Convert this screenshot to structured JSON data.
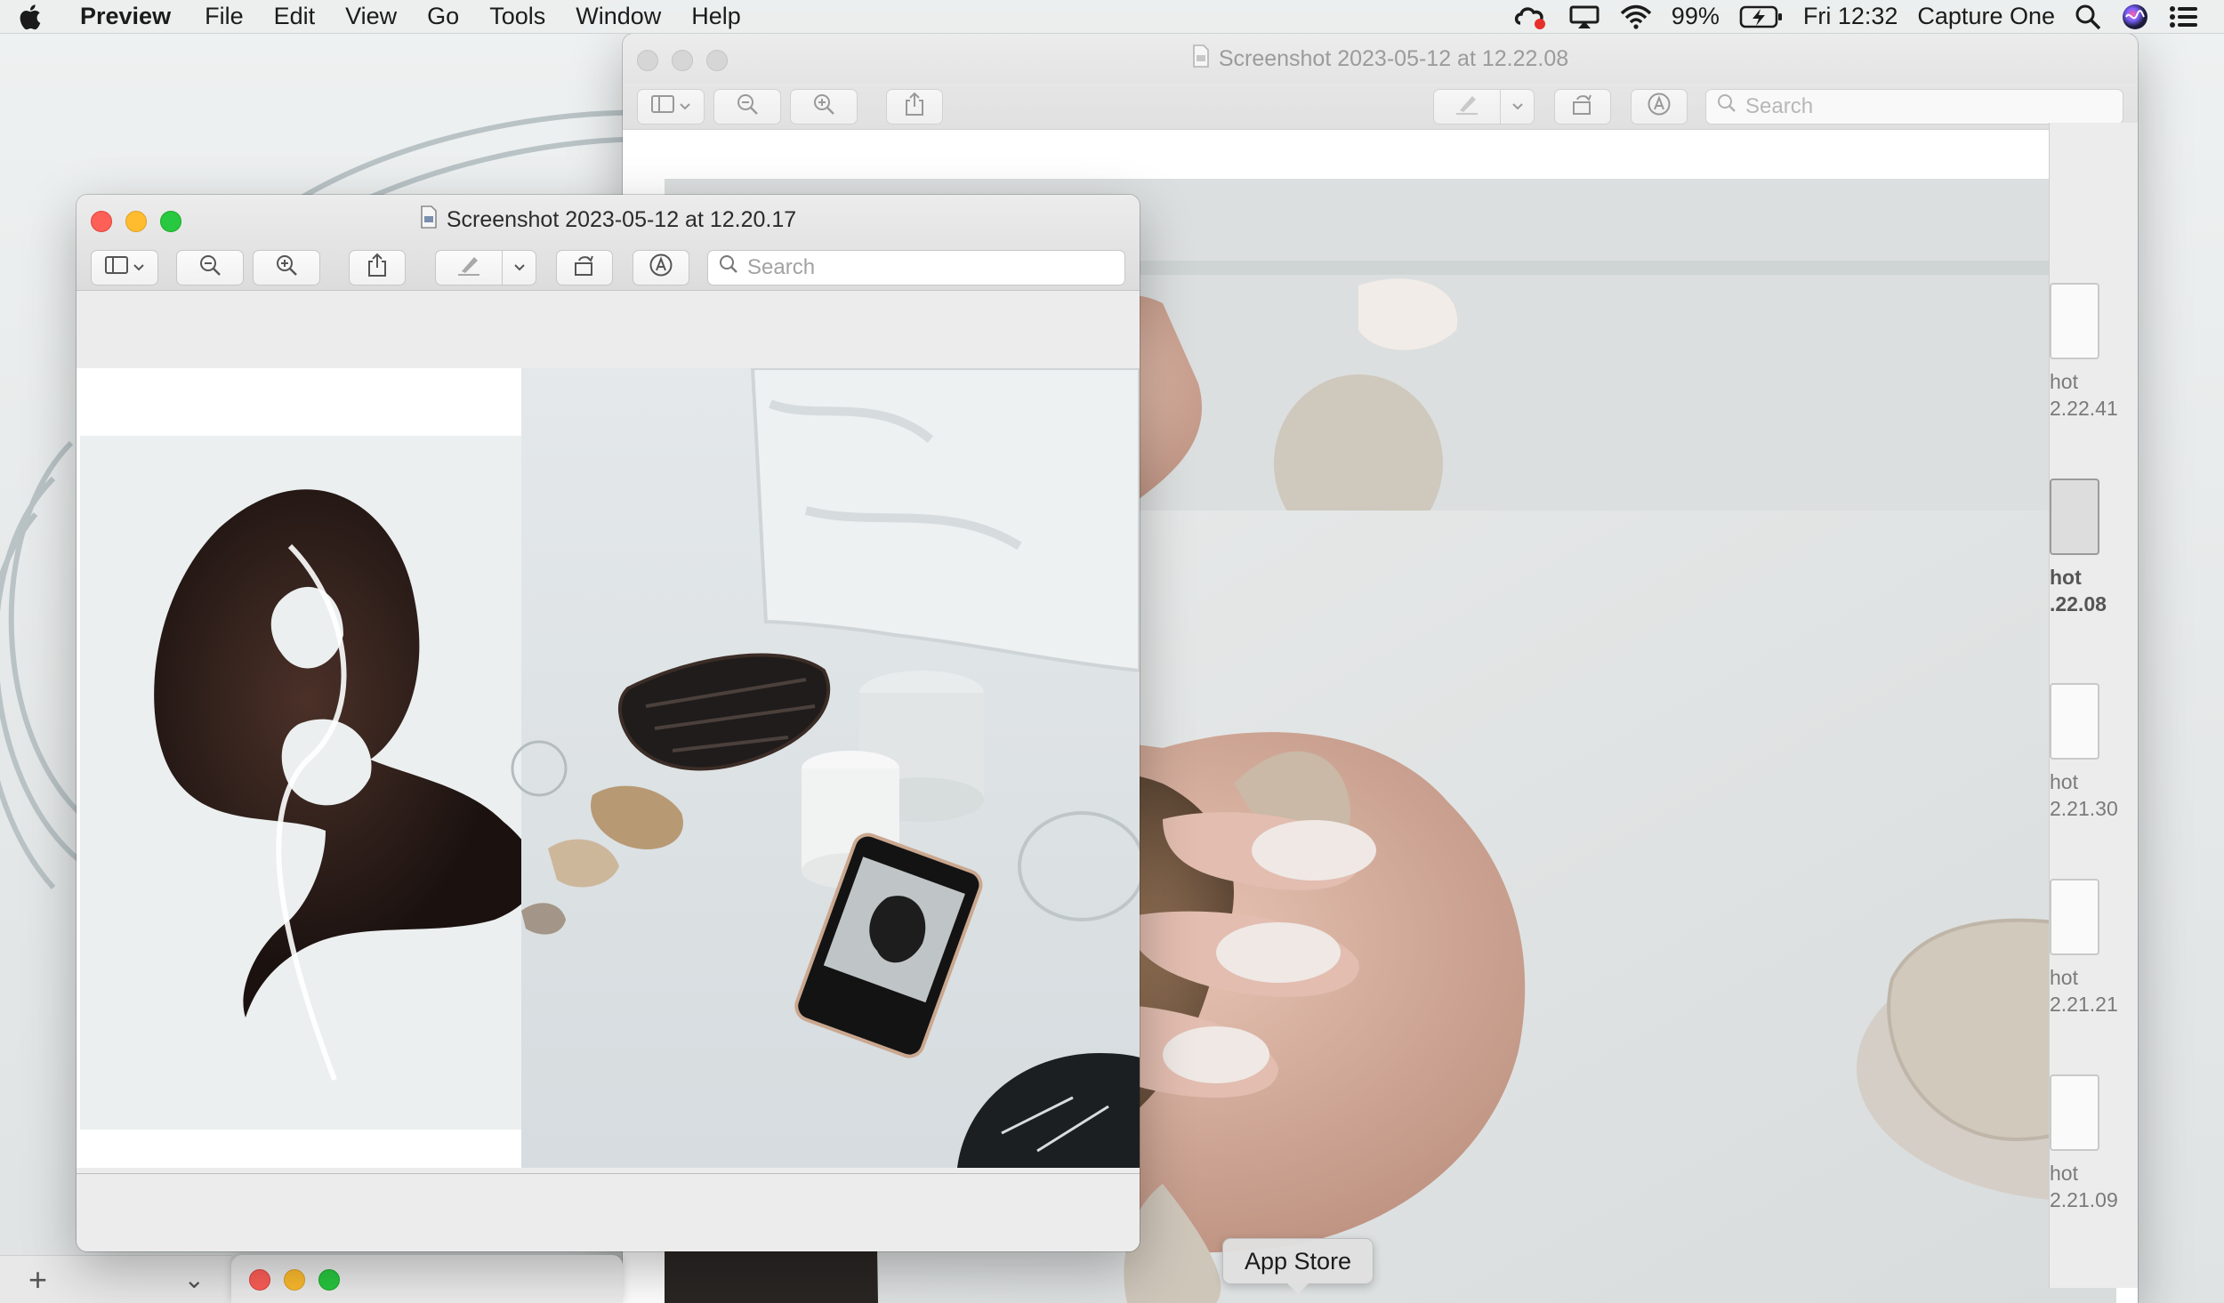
{
  "menubar": {
    "app_name": "Preview",
    "items": [
      "File",
      "Edit",
      "View",
      "Go",
      "Tools",
      "Window",
      "Help"
    ],
    "battery": "99%",
    "clock": "Fri 12:32",
    "active_app": "Capture One",
    "icons": [
      "apple-icon",
      "creative-cloud-icon",
      "airplay-icon",
      "wifi-icon",
      "battery-charging-icon",
      "spotlight-search-icon",
      "siri-icon",
      "control-center-icon"
    ]
  },
  "back_window": {
    "title": "Screenshot 2023-05-12 at 12.22.08",
    "search_placeholder": "Search",
    "thumbnails": [
      {
        "label_line1": "hot",
        "label_line2": "2.22.41",
        "selected": false
      },
      {
        "label_line1": "hot",
        "label_line2": ".22.08",
        "selected": true
      },
      {
        "label_line1": "hot",
        "label_line2": "2.21.30",
        "selected": false
      },
      {
        "label_line1": "hot",
        "label_line2": "2.21.21",
        "selected": false
      },
      {
        "label_line1": "hot",
        "label_line2": "2.21.09",
        "selected": false
      }
    ]
  },
  "front_window": {
    "title": "Screenshot 2023-05-12 at 12.20.17",
    "search_placeholder": "Search"
  },
  "finder": {
    "add_label": "+",
    "chevron_label": "⌄"
  },
  "tooltip": {
    "text": "App Store"
  },
  "colors": {
    "traffic_red": "#fe5f57",
    "traffic_yellow": "#febc2e",
    "traffic_green": "#28c840",
    "tooltip_bg": "#e0e0e0"
  }
}
